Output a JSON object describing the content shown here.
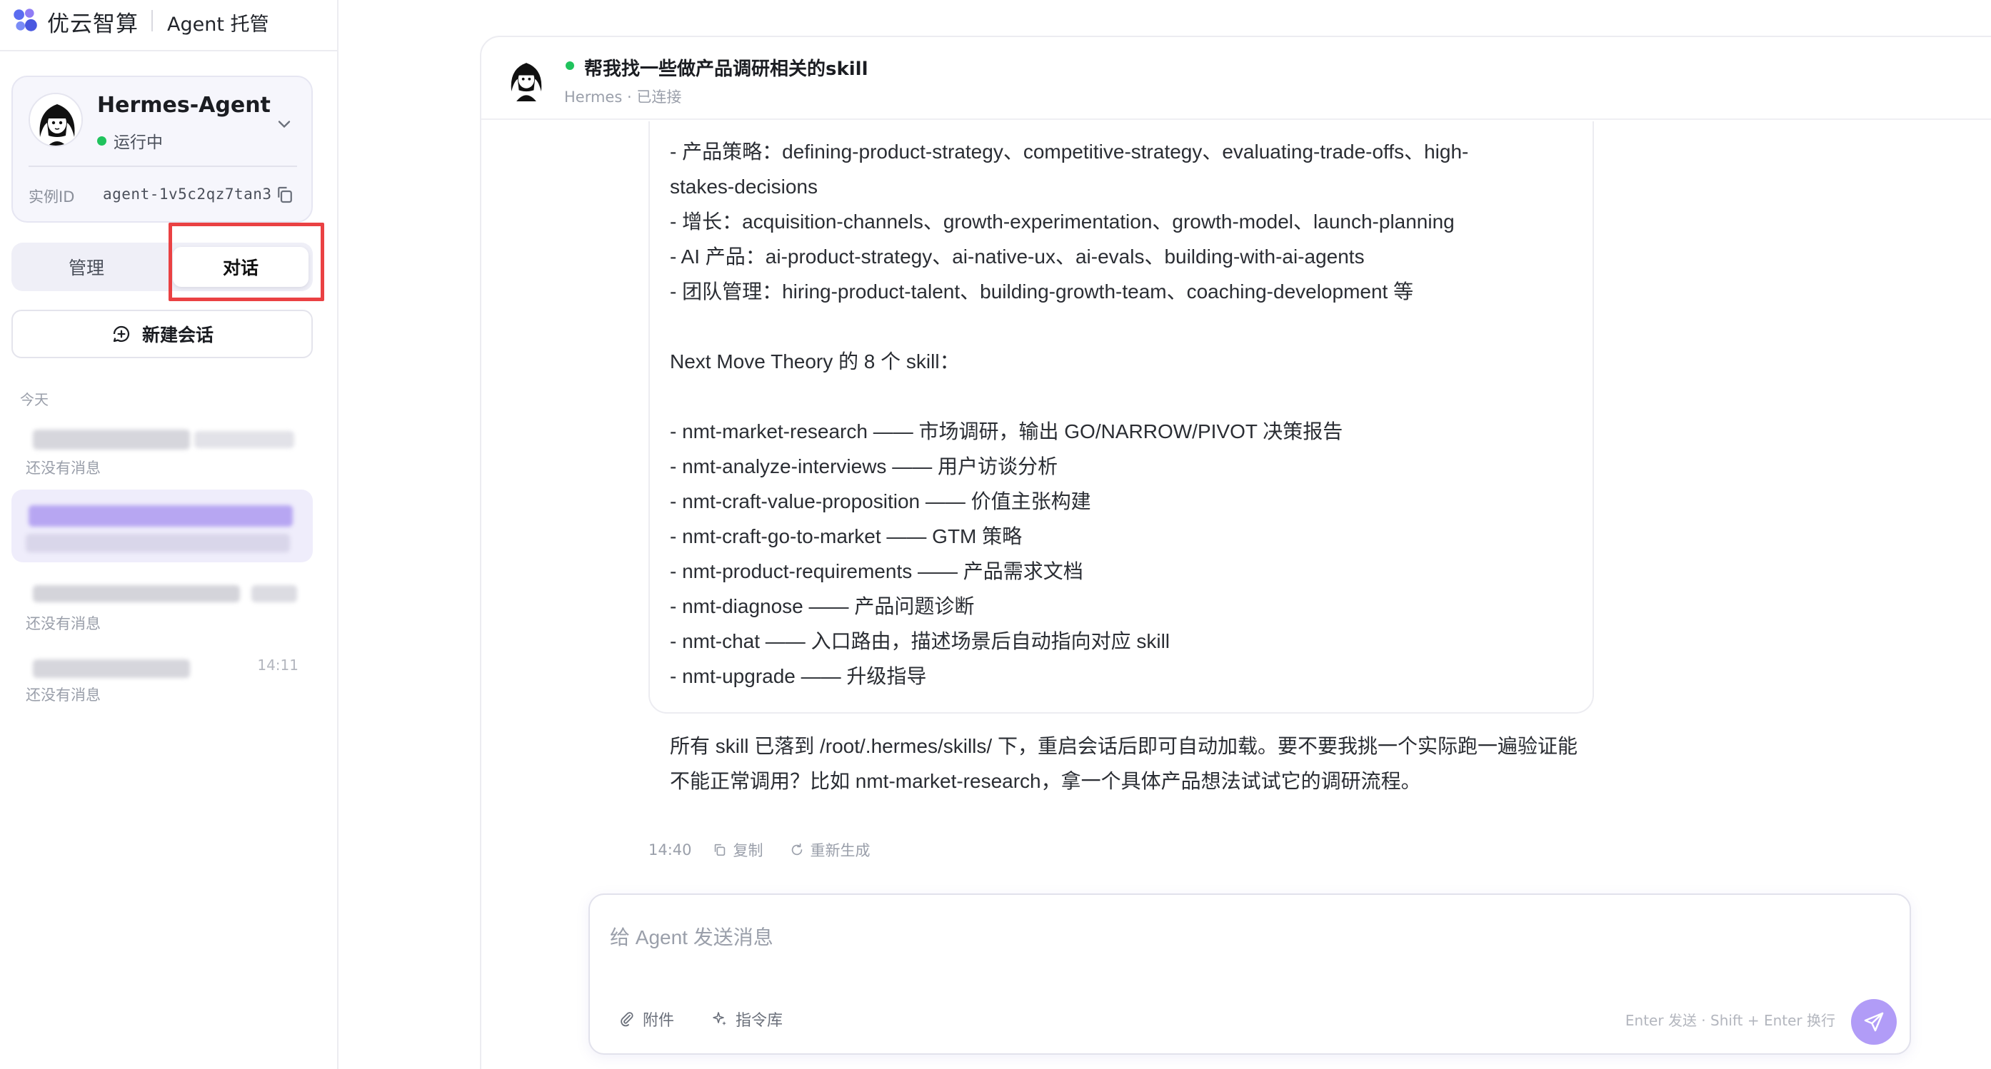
{
  "brand": {
    "name": "优云智算",
    "product": "Agent 托管"
  },
  "agent": {
    "name": "Hermes-Agent",
    "status": "运行中",
    "instance_label": "实例ID",
    "instance_id": "agent-1v5c2qz7tan3"
  },
  "tabs": {
    "manage": "管理",
    "chat": "对话",
    "active": "chat"
  },
  "new_chat_label": "新建会话",
  "history": {
    "group_label": "今天",
    "items": [
      {
        "subtitle": "还没有消息",
        "time": ""
      },
      {
        "subtitle": "",
        "time": ""
      },
      {
        "subtitle": "还没有消息",
        "time": ""
      },
      {
        "subtitle": "还没有消息",
        "time": "14:11"
      }
    ]
  },
  "chat": {
    "title": "帮我找一些做产品调研相关的skill",
    "subtitle": "Hermes · 已连接",
    "message_lines": [
      "- 产品策略：defining-product-strategy、competitive-strategy、evaluating-trade-offs、high-",
      "stakes-decisions",
      "- 增长：acquisition-channels、growth-experimentation、growth-model、launch-planning",
      "- AI 产品：ai-product-strategy、ai-native-ux、ai-evals、building-with-ai-agents",
      "- 团队管理：hiring-product-talent、building-growth-team、coaching-development 等",
      "",
      "Next Move Theory 的 8 个 skill：",
      "",
      "- nmt-market-research —— 市场调研，输出 GO/NARROW/PIVOT 决策报告",
      "- nmt-analyze-interviews —— 用户访谈分析",
      "- nmt-craft-value-proposition —— 价值主张构建",
      "- nmt-craft-go-to-market —— GTM 策略",
      "- nmt-product-requirements —— 产品需求文档",
      "- nmt-diagnose —— 产品问题诊断",
      "- nmt-chat —— 入口路由，描述场景后自动指向对应 skill",
      "- nmt-upgrade —— 升级指导",
      "",
      "所有 skill 已落到 /root/.hermes/skills/ 下，重启会话后即可自动加载。要不要我挑一个实际跑一遍验证能",
      "不能正常调用？比如 nmt-market-research，拿一个具体产品想法试试它的调研流程。"
    ],
    "message_time": "14:40",
    "copy_label": "复制",
    "regenerate_label": "重新生成"
  },
  "composer": {
    "placeholder": "给 Agent 发送消息",
    "attach_label": "附件",
    "commands_label": "指令库",
    "hint": "Enter 发送 · Shift + Enter 换行"
  },
  "colors": {
    "accent": "#b19cf7",
    "status_green": "#20c35d",
    "highlight_red": "#ea4143",
    "active_conv_bg": "#efedfb"
  }
}
